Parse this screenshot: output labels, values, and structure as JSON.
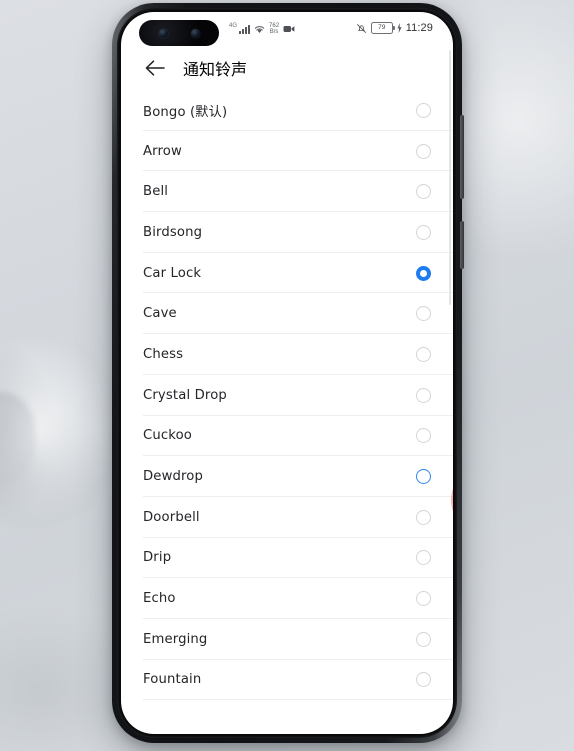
{
  "device": {
    "type": "smartphone",
    "frame_color": "#121316",
    "screen_bg": "#ffffff",
    "background_color": "#d6dade"
  },
  "status_bar": {
    "network_label": "4G",
    "signal_icon": "signal-bars-icon",
    "wifi_icon": "wifi-icon",
    "data_rate_value": "762",
    "data_rate_unit": "B/s",
    "screen_record_icon": "video-recorder-icon",
    "mute_icon": "bell-muted-icon",
    "battery_level": "79",
    "charging_icon": "charging-bolt-icon",
    "time": "11:29"
  },
  "app_bar": {
    "back_icon": "back-arrow-icon",
    "title": "通知铃声"
  },
  "list": {
    "selected_item": "Car Lock",
    "highlighted_item": "Dewdrop",
    "accent_color": "#1e7bf0",
    "items": [
      {
        "label": "Bongo (默认)",
        "state": "unselected"
      },
      {
        "label": "Arrow",
        "state": "unselected"
      },
      {
        "label": "Bell",
        "state": "unselected"
      },
      {
        "label": "Birdsong",
        "state": "unselected"
      },
      {
        "label": "Car Lock",
        "state": "selected"
      },
      {
        "label": "Cave",
        "state": "unselected"
      },
      {
        "label": "Chess",
        "state": "unselected"
      },
      {
        "label": "Crystal Drop",
        "state": "unselected"
      },
      {
        "label": "Cuckoo",
        "state": "unselected"
      },
      {
        "label": "Dewdrop",
        "state": "highlight"
      },
      {
        "label": "Doorbell",
        "state": "unselected"
      },
      {
        "label": "Drip",
        "state": "unselected"
      },
      {
        "label": "Echo",
        "state": "unselected"
      },
      {
        "label": "Emerging",
        "state": "unselected"
      },
      {
        "label": "Fountain",
        "state": "unselected"
      }
    ]
  },
  "overlay": {
    "tap_indicator": "tap-ripple-indicator",
    "cursor": "mouse-cursor-arrow",
    "cursor_color": "#e8231f"
  },
  "hardware": {
    "volume_rocker": "volume-rocker-button",
    "power_button": "power-button",
    "camera_cutout": "dual-punch-hole-camera"
  }
}
